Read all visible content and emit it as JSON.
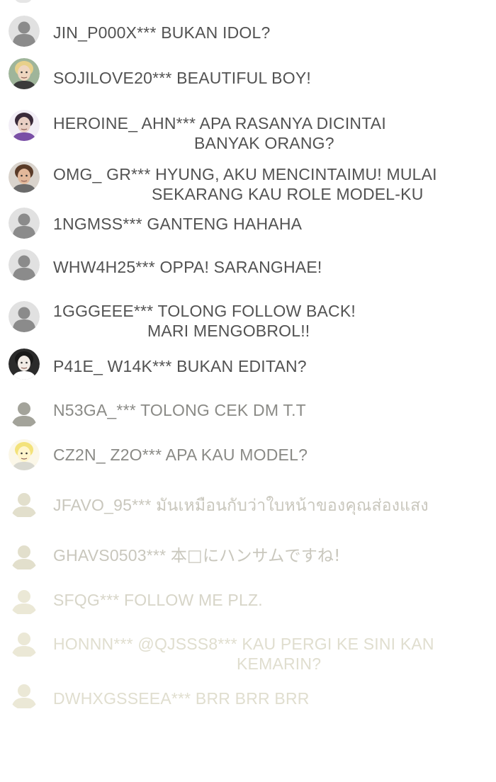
{
  "colors": {
    "text_dark": "#525252",
    "text_mid": "#8a8a86",
    "text_fade1": "#c9c7bd",
    "text_fade2": "#d7d5c8",
    "text_fade3": "#e0decf",
    "avatar_grey": "#8b8b8b",
    "avatar_grey_bg": "#e1e1e1",
    "avatar_beige": "#e2dfcc",
    "avatar_beige_bg": "#faf9f2"
  },
  "comments": [
    {
      "user": "JIN_P000X***",
      "message": "BUKAN IDOL?",
      "message_line2": "",
      "avatar_icon": "default-avatar-icon"
    },
    {
      "user": "SOJILOVE20***",
      "message": "BEAUTIFUL BOY!",
      "message_line2": "",
      "avatar_icon": "user-photo-avatar"
    },
    {
      "user": "HEROINE_ AHN***",
      "message": "APA RASANYA DICINTAI",
      "message_line2": "BANYAK ORANG?",
      "avatar_icon": "user-photo-avatar"
    },
    {
      "user": "OMG_ GR***",
      "message": "HYUNG, AKU MENCINTAIMU! MULAI",
      "message_line2": "SEKARANG KAU ROLE MODEL-KU",
      "avatar_icon": "user-photo-avatar"
    },
    {
      "user": "1NGMSS***",
      "message": "GANTENG HAHAHA",
      "message_line2": "",
      "avatar_icon": "default-avatar-icon"
    },
    {
      "user": "WHW4H25***",
      "message": "OPPA! SARANGHAE!",
      "message_line2": "",
      "avatar_icon": "default-avatar-icon"
    },
    {
      "user": "1GGGEEE***",
      "message": "TOLONG FOLLOW BACK!",
      "message_line2": "MARI MENGOBROL!!",
      "avatar_icon": "default-avatar-icon"
    },
    {
      "user": "P41E_ W14K***",
      "message": "BUKAN EDITAN?",
      "message_line2": "",
      "avatar_icon": "user-photo-avatar"
    },
    {
      "user": "N53GA_***",
      "message": "TOLONG CEK DM T.T",
      "message_line2": "",
      "avatar_icon": "default-avatar-icon"
    },
    {
      "user": "CZ2N_ Z2O***",
      "message": "APA KAU MODEL?",
      "message_line2": "",
      "avatar_icon": "user-photo-avatar"
    },
    {
      "user": "JFAVO_95***",
      "message": "มันเหมือนกับว่าใบหน้าของคุณส่องแสง",
      "message_line2": "",
      "avatar_icon": "default-avatar-icon"
    },
    {
      "user": "GHAVS0503***",
      "message": "本□にハンサムですね!",
      "message_line2": "",
      "avatar_icon": "default-avatar-icon"
    },
    {
      "user": "SFQG***",
      "message": "FOLLOW ME PLZ.",
      "message_line2": "",
      "avatar_icon": "default-avatar-icon"
    },
    {
      "user": "HONNN***",
      "message": "@QJSSS8*** KAU PERGI KE SINI KAN",
      "message_line2": "KEMARIN?",
      "avatar_icon": "default-avatar-icon"
    },
    {
      "user": "DWHXGSSEEA***",
      "message": "BRR BRR BRR",
      "message_line2": "",
      "avatar_icon": "default-avatar-icon"
    }
  ]
}
